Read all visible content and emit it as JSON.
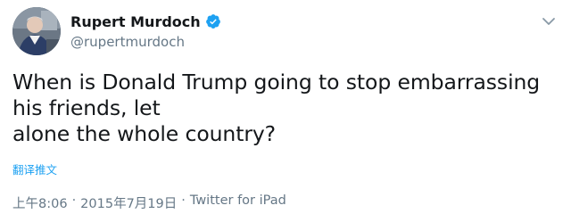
{
  "author": {
    "display_name": "Rupert Murdoch",
    "screen_name": "@rupertmurdoch",
    "verified": true,
    "icons": {
      "avatar": "profile-photo",
      "verified": "verified-badge-icon",
      "menu": "chevron-down-icon"
    }
  },
  "tweet": {
    "text": "When is Donald Trump going to stop embarrassing\nhis friends, let\nalone the whole country?",
    "translate_label": "翻译推文"
  },
  "meta": {
    "time": "上午8:06",
    "separator": "·",
    "date": "2015年7月19日",
    "source": "Twitter for iPad"
  },
  "colors": {
    "link": "#1da1f2",
    "secondary_text": "#657786",
    "primary_text": "#14171a",
    "verified": "#1da1f2"
  }
}
